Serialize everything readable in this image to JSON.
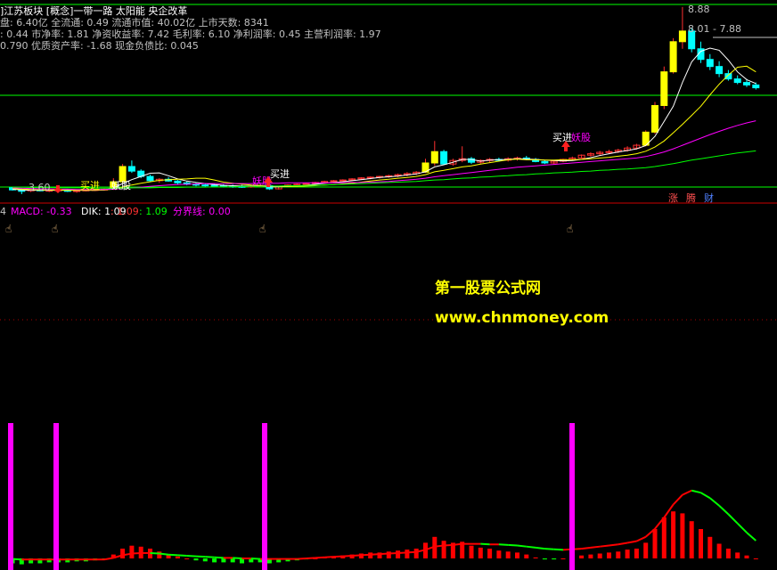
{
  "header": {
    "line1": "]江苏板块 [概念]一带一路 太阳能 央企改革",
    "line2": "盘: 6.40亿 全流通: 0.49 流通市值: 40.02亿 上市天数: 8341",
    "line3": ": 0.44 市净率: 1.81 净资收益率: 7.42 毛利率: 6.10 净利润率: 0.45 主营利润率: 1.97",
    "line4": "0.790 优质资产率: -1.68 现金负债比: 0.045"
  },
  "price_labels": {
    "high": "8.88",
    "range": "8.01 - 7.88",
    "low": "3.60"
  },
  "signals": [
    "买进",
    "妖股",
    "买进",
    "妖股",
    "买进",
    "妖股"
  ],
  "badges": [
    "涨",
    "腾",
    "财"
  ],
  "indicator": {
    "prefix": "4",
    "macd_label": "MACD: -0.33",
    "dik_label": "DIK: 1.09",
    "v1": ": 1.09",
    "v2": ": 1.09",
    "boundary_label": "分界线: 0.00"
  },
  "watermark": {
    "line1": "第一股票公式网",
    "line2": "www.chnmoney.com"
  },
  "colors": {
    "up": "#ff3030",
    "down": "#00ffff",
    "ma5": "#ffffff",
    "ma10": "#ffff00",
    "ma20": "#ff00ff",
    "ma60": "#00ff00",
    "macd_up": "#ff0000",
    "macd_down": "#00ff00",
    "marker": "#ff00ff"
  },
  "chart_data": {
    "type": "candlestick",
    "candles": [
      [
        3.78,
        3.8,
        3.7,
        3.72
      ],
      [
        3.74,
        3.76,
        3.6,
        3.68
      ],
      [
        3.7,
        3.74,
        3.66,
        3.72
      ],
      [
        3.72,
        3.75,
        3.68,
        3.7
      ],
      [
        3.7,
        3.73,
        3.66,
        3.71
      ],
      [
        3.71,
        3.74,
        3.69,
        3.72
      ],
      [
        3.72,
        3.74,
        3.66,
        3.68
      ],
      [
        3.68,
        3.72,
        3.64,
        3.7
      ],
      [
        3.7,
        3.74,
        3.68,
        3.72
      ],
      [
        3.72,
        3.75,
        3.69,
        3.73
      ],
      [
        3.73,
        3.76,
        3.7,
        3.74
      ],
      [
        3.74,
        4.05,
        3.72,
        3.95
      ],
      [
        3.95,
        4.45,
        3.93,
        4.38
      ],
      [
        4.38,
        4.55,
        4.2,
        4.25
      ],
      [
        4.25,
        4.3,
        4.05,
        4.1
      ],
      [
        4.1,
        4.15,
        3.95,
        3.98
      ],
      [
        3.98,
        4.05,
        3.92,
        4.02
      ],
      [
        4.02,
        4.08,
        3.95,
        3.97
      ],
      [
        3.97,
        4.0,
        3.88,
        3.92
      ],
      [
        3.92,
        3.96,
        3.85,
        3.88
      ],
      [
        3.88,
        3.92,
        3.82,
        3.86
      ],
      [
        3.86,
        3.9,
        3.81,
        3.85
      ],
      [
        3.85,
        3.89,
        3.8,
        3.84
      ],
      [
        3.84,
        3.88,
        3.79,
        3.83
      ],
      [
        3.83,
        3.87,
        3.78,
        3.82
      ],
      [
        3.82,
        3.86,
        3.78,
        3.81
      ],
      [
        3.81,
        3.85,
        3.78,
        3.83
      ],
      [
        3.83,
        3.86,
        3.8,
        3.84
      ],
      [
        3.84,
        3.86,
        3.72,
        3.75
      ],
      [
        3.75,
        3.84,
        3.73,
        3.82
      ],
      [
        3.82,
        3.88,
        3.8,
        3.86
      ],
      [
        3.86,
        3.9,
        3.83,
        3.88
      ],
      [
        3.88,
        3.92,
        3.85,
        3.9
      ],
      [
        3.9,
        3.95,
        3.87,
        3.93
      ],
      [
        3.93,
        3.98,
        3.9,
        3.96
      ],
      [
        3.96,
        4.0,
        3.93,
        3.98
      ],
      [
        3.98,
        4.02,
        3.95,
        4.0
      ],
      [
        4.0,
        4.05,
        3.97,
        4.03
      ],
      [
        4.03,
        4.08,
        4.0,
        4.06
      ],
      [
        4.06,
        4.1,
        4.02,
        4.08
      ],
      [
        4.08,
        4.12,
        4.04,
        4.1
      ],
      [
        4.1,
        4.15,
        4.06,
        4.12
      ],
      [
        4.12,
        4.18,
        4.08,
        4.15
      ],
      [
        4.15,
        4.22,
        4.1,
        4.18
      ],
      [
        4.18,
        4.25,
        4.14,
        4.22
      ],
      [
        4.22,
        4.6,
        4.2,
        4.48
      ],
      [
        4.48,
        5.1,
        4.4,
        4.8
      ],
      [
        4.8,
        4.85,
        4.42,
        4.45
      ],
      [
        4.45,
        4.6,
        4.4,
        4.55
      ],
      [
        4.55,
        4.95,
        4.5,
        4.6
      ],
      [
        4.6,
        4.65,
        4.45,
        4.5
      ],
      [
        4.5,
        4.58,
        4.46,
        4.55
      ],
      [
        4.55,
        4.62,
        4.5,
        4.58
      ],
      [
        4.58,
        4.63,
        4.52,
        4.56
      ],
      [
        4.56,
        4.64,
        4.52,
        4.6
      ],
      [
        4.6,
        4.66,
        4.55,
        4.62
      ],
      [
        4.62,
        4.68,
        4.56,
        4.58
      ],
      [
        4.58,
        4.62,
        4.5,
        4.52
      ],
      [
        4.52,
        4.56,
        4.45,
        4.48
      ],
      [
        4.48,
        4.55,
        4.44,
        4.53
      ],
      [
        4.53,
        4.6,
        4.5,
        4.58
      ],
      [
        4.58,
        4.66,
        4.55,
        4.62
      ],
      [
        4.62,
        4.72,
        4.6,
        4.7
      ],
      [
        4.7,
        4.78,
        4.66,
        4.74
      ],
      [
        4.74,
        4.82,
        4.7,
        4.78
      ],
      [
        4.78,
        4.85,
        4.74,
        4.8
      ],
      [
        4.8,
        4.88,
        4.76,
        4.84
      ],
      [
        4.84,
        4.95,
        4.8,
        4.9
      ],
      [
        4.9,
        5.02,
        4.86,
        4.98
      ],
      [
        4.98,
        5.4,
        4.95,
        5.35
      ],
      [
        5.35,
        6.2,
        5.3,
        6.1
      ],
      [
        6.1,
        7.2,
        6.0,
        7.05
      ],
      [
        7.05,
        8.0,
        7.0,
        7.9
      ],
      [
        7.9,
        8.88,
        7.7,
        8.2
      ],
      [
        8.2,
        8.3,
        7.6,
        7.7
      ],
      [
        7.7,
        7.9,
        7.3,
        7.4
      ],
      [
        7.4,
        7.55,
        7.1,
        7.2
      ],
      [
        7.2,
        7.35,
        6.9,
        7.0
      ],
      [
        7.0,
        7.1,
        6.8,
        6.85
      ],
      [
        6.85,
        6.95,
        6.7,
        6.75
      ],
      [
        6.75,
        6.85,
        6.62,
        6.68
      ],
      [
        6.68,
        6.75,
        6.55,
        6.6
      ]
    ],
    "ma5": [
      3.74,
      3.72,
      3.71,
      3.71,
      3.71,
      3.71,
      3.71,
      3.71,
      3.71,
      3.71,
      3.72,
      3.77,
      3.9,
      4.01,
      4.1,
      4.19,
      4.2,
      4.12,
      4.03,
      3.97,
      3.93,
      3.9,
      3.87,
      3.85,
      3.84,
      3.83,
      3.83,
      3.83,
      3.81,
      3.81,
      3.82,
      3.83,
      3.85,
      3.88,
      3.91,
      3.93,
      3.95,
      3.98,
      4.01,
      4.04,
      4.07,
      4.09,
      4.11,
      4.14,
      4.17,
      4.23,
      4.37,
      4.43,
      4.5,
      4.58,
      4.58,
      4.53,
      4.56,
      4.57,
      4.58,
      4.6,
      4.59,
      4.58,
      4.56,
      4.55,
      4.54,
      4.55,
      4.58,
      4.63,
      4.69,
      4.74,
      4.79,
      4.83,
      4.88,
      4.97,
      5.23,
      5.65,
      6.08,
      6.75,
      7.33,
      7.63,
      7.72,
      7.66,
      7.38,
      7.05,
      6.83,
      6.72
    ],
    "ma10": [
      3.76,
      3.74,
      3.73,
      3.72,
      3.72,
      3.72,
      3.71,
      3.71,
      3.71,
      3.71,
      3.72,
      3.74,
      3.8,
      3.86,
      3.91,
      3.95,
      3.99,
      4.01,
      4.02,
      4.03,
      4.05,
      4.05,
      4.0,
      3.94,
      3.91,
      3.88,
      3.86,
      3.85,
      3.83,
      3.82,
      3.82,
      3.82,
      3.83,
      3.84,
      3.86,
      3.87,
      3.89,
      3.91,
      3.94,
      3.97,
      4.0,
      4.02,
      4.05,
      4.07,
      4.1,
      4.15,
      4.23,
      4.27,
      4.32,
      4.37,
      4.4,
      4.45,
      4.49,
      4.53,
      4.57,
      4.59,
      4.57,
      4.57,
      4.56,
      4.56,
      4.57,
      4.57,
      4.58,
      4.6,
      4.62,
      4.64,
      4.67,
      4.7,
      4.74,
      4.81,
      4.93,
      5.1,
      5.33,
      5.57,
      5.82,
      6.08,
      6.4,
      6.7,
      6.96,
      7.18,
      7.21,
      7.05
    ],
    "ma20": [
      3.78,
      3.77,
      3.76,
      3.75,
      3.75,
      3.74,
      3.74,
      3.73,
      3.73,
      3.73,
      3.73,
      3.74,
      3.76,
      3.78,
      3.8,
      3.82,
      3.84,
      3.86,
      3.87,
      3.88,
      3.89,
      3.9,
      3.9,
      3.9,
      3.9,
      3.9,
      3.9,
      3.91,
      3.91,
      3.91,
      3.92,
      3.92,
      3.92,
      3.92,
      3.92,
      3.92,
      3.92,
      3.93,
      3.93,
      3.94,
      3.95,
      3.96,
      3.98,
      4.0,
      4.02,
      4.05,
      4.09,
      4.12,
      4.15,
      4.18,
      4.21,
      4.24,
      4.27,
      4.3,
      4.33,
      4.36,
      4.38,
      4.4,
      4.42,
      4.44,
      4.46,
      4.48,
      4.5,
      4.52,
      4.54,
      4.56,
      4.58,
      4.6,
      4.62,
      4.66,
      4.72,
      4.79,
      4.88,
      4.98,
      5.08,
      5.18,
      5.28,
      5.37,
      5.46,
      5.54,
      5.61,
      5.67
    ],
    "ma60": [
      3.8,
      3.8,
      3.79,
      3.79,
      3.79,
      3.78,
      3.78,
      3.78,
      3.78,
      3.77,
      3.77,
      3.77,
      3.77,
      3.78,
      3.78,
      3.78,
      3.79,
      3.79,
      3.79,
      3.8,
      3.8,
      3.8,
      3.81,
      3.81,
      3.81,
      3.82,
      3.82,
      3.82,
      3.83,
      3.83,
      3.84,
      3.84,
      3.85,
      3.85,
      3.86,
      3.87,
      3.88,
      3.89,
      3.9,
      3.91,
      3.92,
      3.93,
      3.94,
      3.95,
      3.96,
      3.98,
      4.0,
      4.01,
      4.03,
      4.05,
      4.06,
      4.08,
      4.09,
      4.11,
      4.12,
      4.14,
      4.15,
      4.17,
      4.18,
      4.2,
      4.21,
      4.22,
      4.24,
      4.25,
      4.27,
      4.28,
      4.3,
      4.31,
      4.33,
      4.35,
      4.38,
      4.42,
      4.46,
      4.51,
      4.56,
      4.6,
      4.64,
      4.68,
      4.72,
      4.76,
      4.79,
      4.82
    ],
    "macd_hist": [
      -0.05,
      -0.06,
      -0.05,
      -0.05,
      -0.04,
      -0.04,
      -0.04,
      -0.03,
      -0.03,
      -0.02,
      -0.01,
      0.04,
      0.1,
      0.13,
      0.12,
      0.1,
      0.07,
      0.04,
      0.02,
      0.0,
      -0.02,
      -0.03,
      -0.04,
      -0.04,
      -0.04,
      -0.05,
      -0.04,
      -0.04,
      -0.05,
      -0.04,
      -0.03,
      -0.02,
      -0.01,
      0.0,
      0.01,
      0.02,
      0.03,
      0.04,
      0.05,
      0.06,
      0.06,
      0.07,
      0.08,
      0.09,
      0.1,
      0.16,
      0.22,
      0.18,
      0.16,
      0.17,
      0.13,
      0.11,
      0.1,
      0.08,
      0.07,
      0.06,
      0.04,
      0.01,
      -0.01,
      -0.01,
      0.0,
      0.01,
      0.03,
      0.04,
      0.05,
      0.06,
      0.07,
      0.09,
      0.1,
      0.16,
      0.3,
      0.42,
      0.48,
      0.46,
      0.38,
      0.3,
      0.22,
      0.15,
      0.1,
      0.06,
      0.03,
      0.0
    ],
    "dif": [
      -0.01,
      -0.02,
      -0.02,
      -0.02,
      -0.02,
      -0.02,
      -0.02,
      -0.02,
      -0.02,
      -0.02,
      -0.02,
      0.01,
      0.06,
      0.09,
      0.1,
      0.1,
      0.09,
      0.07,
      0.06,
      0.05,
      0.04,
      0.03,
      0.02,
      0.01,
      0.01,
      0.0,
      0.0,
      -0.01,
      -0.01,
      -0.01,
      -0.01,
      -0.01,
      0.0,
      0.01,
      0.02,
      0.03,
      0.04,
      0.05,
      0.06,
      0.07,
      0.08,
      0.09,
      0.1,
      0.11,
      0.12,
      0.16,
      0.22,
      0.24,
      0.25,
      0.27,
      0.27,
      0.27,
      0.26,
      0.26,
      0.25,
      0.24,
      0.22,
      0.2,
      0.18,
      0.17,
      0.16,
      0.17,
      0.18,
      0.2,
      0.22,
      0.24,
      0.26,
      0.29,
      0.32,
      0.4,
      0.55,
      0.76,
      1.0,
      1.18,
      1.26,
      1.22,
      1.12,
      0.98,
      0.82,
      0.65,
      0.48,
      0.33
    ],
    "markers_at": [
      1,
      12,
      37,
      80
    ]
  }
}
